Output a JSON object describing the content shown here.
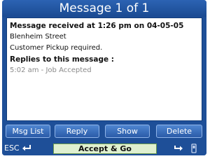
{
  "title": "Message 1 of 1",
  "message": {
    "header": "Message received at 1:26 pm on 04-05-05",
    "lines": [
      "Blenheim Street",
      "Customer Pickup required."
    ],
    "replies_heading": "Replies to this message :",
    "replies": [
      "5:02 am - Job Accepted"
    ]
  },
  "buttons": {
    "msg_list": "Msg List",
    "reply": "Reply",
    "show": "Show",
    "delete": "Delete"
  },
  "bottom": {
    "esc_label": "ESC",
    "accept_label": "Accept & Go"
  },
  "icons": {
    "back": "return-arrow-icon",
    "forward": "forward-arrow-icon",
    "device": "phone-icon"
  },
  "colors": {
    "accent": "#1e4f98",
    "accept_bg": "#dff0d0"
  }
}
